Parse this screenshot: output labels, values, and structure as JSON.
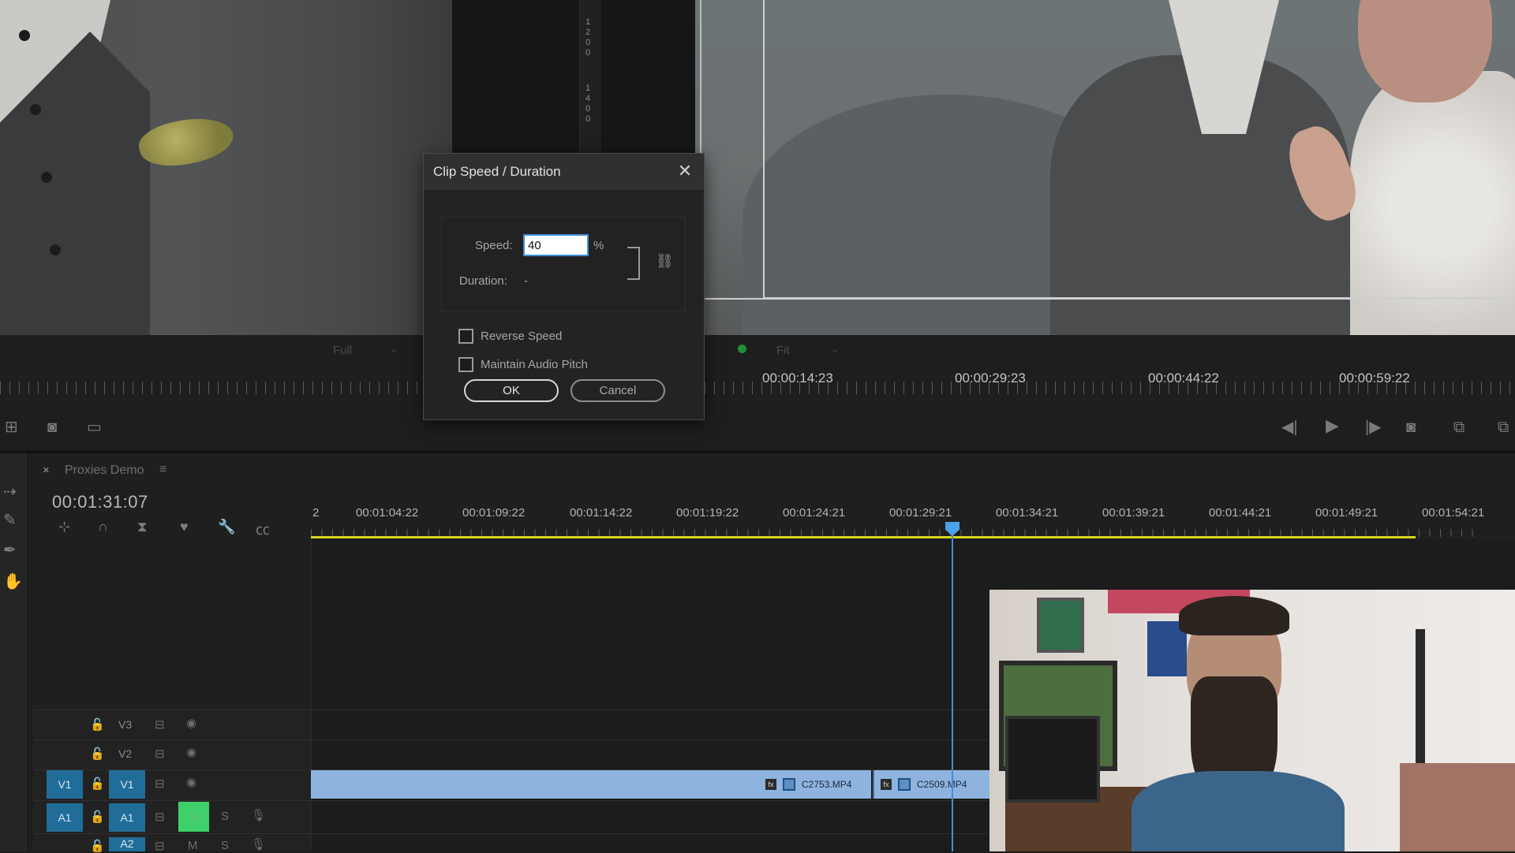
{
  "dialog": {
    "title": "Clip Speed / Duration",
    "speed_label": "Speed:",
    "speed_value": "40",
    "speed_unit": "%",
    "duration_label": "Duration:",
    "duration_value": "-",
    "reverse_speed_label": "Reverse Speed",
    "reverse_speed_checked": false,
    "maintain_pitch_label": "Maintain Audio Pitch",
    "maintain_pitch_checked": false,
    "ok_label": "OK",
    "cancel_label": "Cancel"
  },
  "source_monitor": {
    "zoom_label": "Full",
    "ruler_numbers": [
      "1200",
      "1400"
    ]
  },
  "program_monitor": {
    "zoom_label": "Fit",
    "timecodes": [
      "00:00:14:23",
      "00:00:29:23",
      "00:00:44:22",
      "00:00:59:22"
    ]
  },
  "timeline": {
    "close": "×",
    "sequence_name": "Proxies Demo",
    "menu": "≡",
    "current_timecode": "00:01:31:07",
    "ruler_start": "2",
    "ruler_labels": [
      "00:01:04:22",
      "00:01:09:22",
      "00:01:14:22",
      "00:01:19:22",
      "00:01:24:21",
      "00:01:29:21",
      "00:01:34:21",
      "00:01:39:21",
      "00:01:44:21",
      "00:01:49:21",
      "00:01:54:21"
    ],
    "tracks": {
      "v3": "V3",
      "v2": "V2",
      "v1": "V1",
      "v1_source": "V1",
      "a1": "A1",
      "a1_source": "A1",
      "a2": "A2",
      "mute": "M",
      "solo": "S"
    },
    "clips": [
      {
        "name": "C2753.MP4"
      },
      {
        "name": "C2509.MP4"
      }
    ],
    "fx_badge": "fx"
  },
  "colors": {
    "playhead": "#4aa3ea",
    "work_area": "#d9d51b",
    "clip_video": "#8eb3de",
    "track_target": "#1f6d98",
    "mute_active": "#3fcf6b",
    "focus_ring": "#3f8ed9"
  },
  "icons": {
    "dialog_close": "close-icon",
    "link": "link-icon",
    "play": "play-icon",
    "step_back": "step-back-icon",
    "step_forward": "step-forward-icon",
    "export_frame": "camera-icon"
  }
}
